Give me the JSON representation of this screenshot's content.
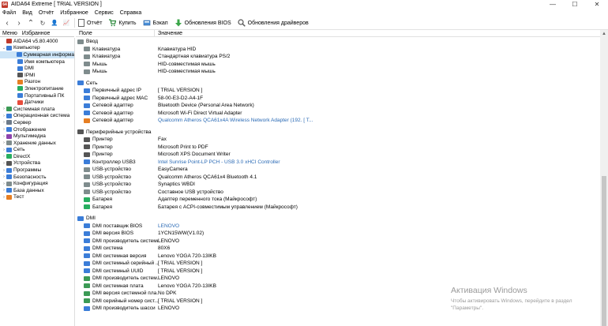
{
  "window": {
    "title": "AIDA64 Extreme  [ TRIAL VERSION ]",
    "logo": "64",
    "minimize": "—",
    "maximize": "☐",
    "close": "✕"
  },
  "menu": [
    "Файл",
    "Вид",
    "Отчёт",
    "Избранное",
    "Сервис",
    "Справка"
  ],
  "toolbar": {
    "nav_back": "‹",
    "nav_forward": "›",
    "nav_up": "⌃",
    "nav_refresh": "↻",
    "nav_user": "👤",
    "nav_chart": "📈",
    "report": "Отчёт",
    "buy": "Купить",
    "backup": "Бэкап",
    "bios_update": "Обновления BIOS",
    "driver_update": "Обновления драйверов"
  },
  "left_tabs": [
    "Меню",
    "Избранное"
  ],
  "tree": [
    {
      "label": "AIDA64 v5.80.4000",
      "level": 0,
      "chev": "",
      "color": "#c0392b"
    },
    {
      "label": "Компьютер",
      "level": 0,
      "chev": "⌄",
      "color": "#3b7dd8"
    },
    {
      "label": "Суммарная информа",
      "level": 1,
      "chev": "",
      "color": "#3b7dd8",
      "selected": true
    },
    {
      "label": "Имя компьютера",
      "level": 1,
      "chev": "",
      "color": "#3b7dd8"
    },
    {
      "label": "DMI",
      "level": 1,
      "chev": "",
      "color": "#3b7dd8"
    },
    {
      "label": "IPMI",
      "level": 1,
      "chev": "",
      "color": "#555555"
    },
    {
      "label": "Разгон",
      "level": 1,
      "chev": "",
      "color": "#e67e22"
    },
    {
      "label": "Электропитание",
      "level": 1,
      "chev": "",
      "color": "#27ae60"
    },
    {
      "label": "Портативный ПК",
      "level": 1,
      "chev": "",
      "color": "#3b7dd8"
    },
    {
      "label": "Датчики",
      "level": 1,
      "chev": "",
      "color": "#e74c3c"
    },
    {
      "label": "Системная плата",
      "level": 0,
      "chev": "›",
      "color": "#3b9a55"
    },
    {
      "label": "Операционная система",
      "level": 0,
      "chev": "›",
      "color": "#3b7dd8"
    },
    {
      "label": "Сервер",
      "level": 0,
      "chev": "›",
      "color": "#6c7a89"
    },
    {
      "label": "Отображение",
      "level": 0,
      "chev": "›",
      "color": "#3b7dd8"
    },
    {
      "label": "Мультимедиа",
      "level": 0,
      "chev": "›",
      "color": "#8e44ad"
    },
    {
      "label": "Хранение данных",
      "level": 0,
      "chev": "›",
      "color": "#7f8c8d"
    },
    {
      "label": "Сеть",
      "level": 0,
      "chev": "›",
      "color": "#3b7dd8"
    },
    {
      "label": "DirectX",
      "level": 0,
      "chev": "›",
      "color": "#27ae60"
    },
    {
      "label": "Устройства",
      "level": 0,
      "chev": "›",
      "color": "#555555"
    },
    {
      "label": "Программы",
      "level": 0,
      "chev": "›",
      "color": "#3b7dd8"
    },
    {
      "label": "Безопасность",
      "level": 0,
      "chev": "›",
      "color": "#3b7dd8"
    },
    {
      "label": "Конфигурация",
      "level": 0,
      "chev": "›",
      "color": "#7f8c8d"
    },
    {
      "label": "База данных",
      "level": 0,
      "chev": "›",
      "color": "#3b7dd8"
    },
    {
      "label": "Тест",
      "level": 0,
      "chev": "›",
      "color": "#e67e22"
    }
  ],
  "columns": {
    "field": "Поле",
    "value": "Значение"
  },
  "sections": [
    {
      "title": "Ввод",
      "icon_color": "#7f8c8d",
      "rows": [
        {
          "f": "Клавиатура",
          "v": "Клавиатура HID",
          "c": "#7f8c8d"
        },
        {
          "f": "Клавиатура",
          "v": "Стандартная клавиатура PS/2",
          "c": "#7f8c8d"
        },
        {
          "f": "Мышь",
          "v": "HID-совместимая мышь",
          "c": "#7f8c8d"
        },
        {
          "f": "Мышь",
          "v": "HID-совместимая мышь",
          "c": "#7f8c8d"
        }
      ]
    },
    {
      "title": "Сеть",
      "icon_color": "#3b7dd8",
      "rows": [
        {
          "f": "Первичный адрес IP",
          "v": "[ TRIAL VERSION ]",
          "c": "#3b7dd8"
        },
        {
          "f": "Первичный адрес MAC",
          "v": "58-00-E3-D2-A4-1F",
          "c": "#3b7dd8"
        },
        {
          "f": "Сетевой адаптер",
          "v": "Bluetooth Device (Personal Area Network)",
          "c": "#3b7dd8"
        },
        {
          "f": "Сетевой адаптер",
          "v": "Microsoft Wi-Fi Direct Virtual Adapter",
          "c": "#3b7dd8"
        },
        {
          "f": "Сетевой адаптер",
          "v": "Qualcomm Atheros QCA61x4A Wireless Network Adapter  (192. [ T...",
          "c": "#e67e22",
          "link": true
        }
      ]
    },
    {
      "title": "Периферийные устройства",
      "icon_color": "#555555",
      "rows": [
        {
          "f": "Принтер",
          "v": "Fax",
          "c": "#555555"
        },
        {
          "f": "Принтер",
          "v": "Microsoft Print to PDF",
          "c": "#555555"
        },
        {
          "f": "Принтер",
          "v": "Microsoft XPS Document Writer",
          "c": "#555555"
        },
        {
          "f": "Контроллер USB3",
          "v": "Intel Sunrise Point-LP PCH - USB 3.0 xHCI Controller",
          "c": "#3b7dd8",
          "link": true
        },
        {
          "f": "USB-устройство",
          "v": "EasyCamera",
          "c": "#7f8c8d"
        },
        {
          "f": "USB-устройство",
          "v": "Qualcomm Atheros QCA61x4 Bluetooth 4.1",
          "c": "#7f8c8d"
        },
        {
          "f": "USB-устройство",
          "v": "Synaptics WBDI",
          "c": "#7f8c8d"
        },
        {
          "f": "USB-устройство",
          "v": "Составное USB устройство",
          "c": "#7f8c8d"
        },
        {
          "f": "Батарея",
          "v": "Адаптер переменного тока (Майкрософт)",
          "c": "#27ae60"
        },
        {
          "f": "Батарея",
          "v": "Батарея с ACPI-совместимым управлением (Майкрософт)",
          "c": "#27ae60"
        }
      ]
    },
    {
      "title": "DMI",
      "icon_color": "#3b7dd8",
      "rows": [
        {
          "f": "DMI поставщик BIOS",
          "v": "LENOVO",
          "c": "#3b7dd8",
          "link": true
        },
        {
          "f": "DMI версия BIOS",
          "v": "1YCN15WW(V1.02)",
          "c": "#3b7dd8"
        },
        {
          "f": "DMI производитель системы",
          "v": "LENOVO",
          "c": "#3b7dd8"
        },
        {
          "f": "DMI система",
          "v": "80X6",
          "c": "#3b7dd8"
        },
        {
          "f": "DMI системная версия",
          "v": "Lenovo YOGA 720-13IKB",
          "c": "#3b7dd8"
        },
        {
          "f": "DMI системный серийный ...",
          "v": "[ TRIAL VERSION ]",
          "c": "#3b7dd8"
        },
        {
          "f": "DMI системный UUID",
          "v": "[ TRIAL VERSION ]",
          "c": "#3b7dd8"
        },
        {
          "f": "DMI производитель систем...",
          "v": "LENOVO",
          "c": "#3b9a55"
        },
        {
          "f": "DMI системная плата",
          "v": "Lenovo YOGA 720-13IKB",
          "c": "#3b9a55"
        },
        {
          "f": "DMI версия системной пла...",
          "v": "No DPK",
          "c": "#3b9a55"
        },
        {
          "f": "DMI серийный номер сист...",
          "v": "[ TRIAL VERSION ]",
          "c": "#3b9a55"
        },
        {
          "f": "DMI производитель шасси",
          "v": "LENOVO",
          "c": "#3b7dd8"
        }
      ]
    }
  ],
  "watermark": {
    "title": "Активация Windows",
    "line1": "Чтобы активировать Windows, перейдите в раздел",
    "line2": "\"Параметры\"."
  },
  "scrollbar": {
    "up": "▲",
    "position_fraction": 0.5
  }
}
